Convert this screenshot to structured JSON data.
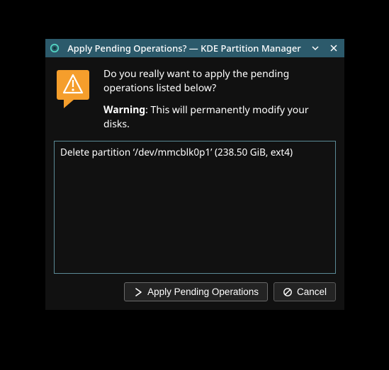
{
  "titlebar": {
    "title": "Apply Pending Operations? — KDE Partition Manager"
  },
  "message": {
    "question": "Do you really want to apply the pending operations listed below?",
    "warning_label": "Warning",
    "warning_rest": ": This will permanently modify your disks."
  },
  "operations": [
    "Delete partition ‘/dev/mmcblk0p1’ (238.50 GiB, ext4)"
  ],
  "buttons": {
    "apply": "Apply Pending Operations",
    "cancel": "Cancel"
  }
}
